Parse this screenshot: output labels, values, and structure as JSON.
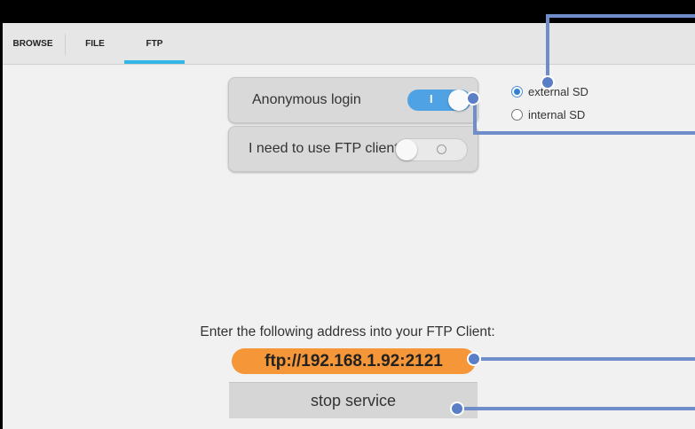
{
  "tabs": [
    {
      "label": "BROWSE"
    },
    {
      "label": "FILE"
    },
    {
      "label": "FTP"
    }
  ],
  "active_tab": "FTP",
  "options": {
    "anonymous_login": {
      "label": "Anonymous login",
      "toggle_text": "I",
      "state": "on"
    },
    "ftp_client": {
      "label": "I need to use FTP client",
      "state": "off"
    }
  },
  "storage": [
    {
      "label": "external SD",
      "checked": true
    },
    {
      "label": "internal SD",
      "checked": false
    }
  ],
  "instruction": "Enter the following address into your FTP Client:",
  "address": "ftp://192.168.1.92:2121",
  "stop_button": "stop service",
  "colors": {
    "accent": "#33b5e5",
    "toggle_on": "#4fa3e4",
    "address_highlight": "#f59738",
    "annotation": "#6f8dc8"
  }
}
